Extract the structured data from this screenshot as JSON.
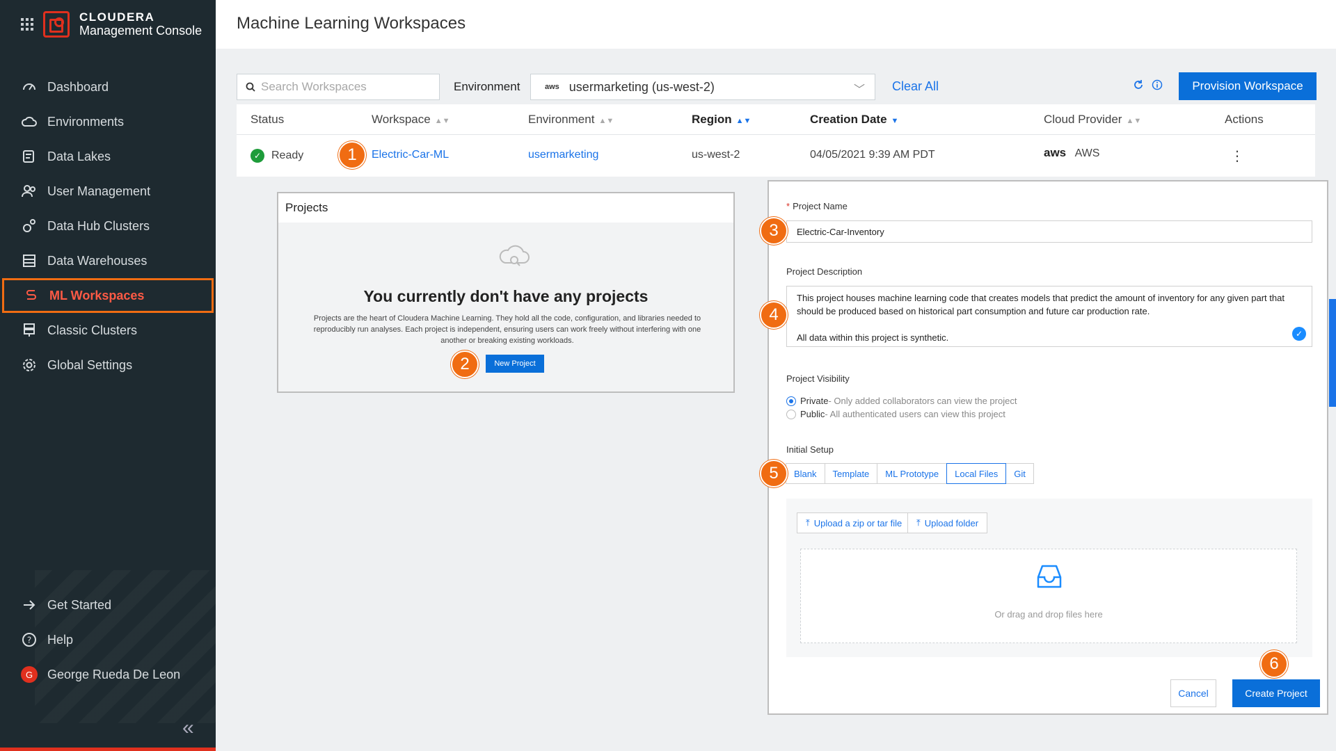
{
  "brand": {
    "name": "CLOUDERA",
    "product": "Management Console"
  },
  "sidebar": {
    "items": [
      {
        "label": "Dashboard",
        "icon": "dashboard-icon"
      },
      {
        "label": "Environments",
        "icon": "cloud-icon"
      },
      {
        "label": "Data Lakes",
        "icon": "data-lake-icon"
      },
      {
        "label": "User Management",
        "icon": "users-icon"
      },
      {
        "label": "Data Hub Clusters",
        "icon": "cluster-icon"
      },
      {
        "label": "Data Warehouses",
        "icon": "warehouse-icon"
      },
      {
        "label": "ML Workspaces",
        "icon": "ml-icon",
        "active": true
      },
      {
        "label": "Classic Clusters",
        "icon": "server-icon"
      },
      {
        "label": "Global Settings",
        "icon": "gear-icon"
      }
    ],
    "bottom": [
      {
        "label": "Get Started",
        "icon": "arrow-right-icon"
      },
      {
        "label": "Help",
        "icon": "help-icon"
      },
      {
        "label": "George Rueda De Leon",
        "icon": "avatar",
        "initial": "G"
      }
    ],
    "collapse_symbol": "«"
  },
  "header": {
    "title": "Machine Learning Workspaces"
  },
  "toolbar": {
    "search_placeholder": "Search Workspaces",
    "environment_label": "Environment",
    "environment_provider": "aws",
    "environment_value": "usermarketing (us-west-2)",
    "clear_all": "Clear All",
    "provision": "Provision Workspace"
  },
  "table": {
    "columns": [
      "Status",
      "Workspace",
      "Environment",
      "Region",
      "Creation Date",
      "Cloud Provider",
      "Actions"
    ],
    "rows": [
      {
        "status": "Ready",
        "workspace": "Electric-Car-ML",
        "environment": "usermarketing",
        "region": "us-west-2",
        "creation_date": "04/05/2021 9:39 AM PDT",
        "provider_logo": "aws",
        "provider": "AWS"
      }
    ]
  },
  "projects": {
    "title": "Projects",
    "empty_title": "You currently don't have any projects",
    "empty_desc": "Projects are the heart of Cloudera Machine Learning. They hold all the code, configuration, and libraries needed to reproducibly run analyses. Each project is independent, ensuring users can work freely without interfering with one another or breaking existing workloads.",
    "new_project": "New Project"
  },
  "form": {
    "project_name_label": "Project Name",
    "project_name_value": "Electric-Car-Inventory",
    "description_label": "Project Description",
    "description_line1": "This project houses machine learning code that creates models that predict the amount of inventory for any given part that should be produced based on historical part consumption and future car production rate.",
    "description_line2": "All data within this project is synthetic.",
    "visibility_label": "Project Visibility",
    "visibility_private": "Private",
    "visibility_private_desc": " - Only added collaborators can view the project",
    "visibility_public": "Public",
    "visibility_public_desc": " - All authenticated users can view this project",
    "setup_label": "Initial Setup",
    "setup_tabs": [
      "Blank",
      "Template",
      "ML Prototype",
      "Local Files",
      "Git"
    ],
    "setup_selected": "Local Files",
    "upload_zip": "Upload a zip or tar file",
    "upload_folder": "Upload folder",
    "drop_text": "Or drag and drop files here",
    "cancel": "Cancel",
    "create": "Create Project"
  },
  "callouts": [
    "1",
    "2",
    "3",
    "4",
    "5",
    "6"
  ],
  "colors": {
    "sidebar_bg": "#1e2a30",
    "accent_orange": "#f06c12",
    "brand_red": "#e0301e",
    "primary_blue": "#0a6fd9",
    "ready_green": "#1e9c3a"
  }
}
